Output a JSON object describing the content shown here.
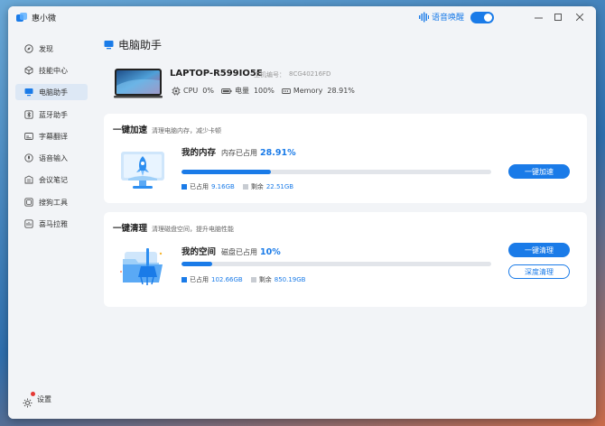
{
  "app": {
    "name": "惠小微"
  },
  "titlebar": {
    "wake_label": "语音唤醒",
    "wake_enabled": true
  },
  "sidebar": {
    "items": [
      {
        "label": "发现",
        "icon": "compass-icon"
      },
      {
        "label": "技能中心",
        "icon": "cube-icon"
      },
      {
        "label": "电脑助手",
        "icon": "monitor-icon",
        "active": true
      },
      {
        "label": "蓝牙助手",
        "icon": "bluetooth-icon"
      },
      {
        "label": "字幕翻译",
        "icon": "subtitle-icon"
      },
      {
        "label": "语音输入",
        "icon": "microphone-icon"
      },
      {
        "label": "会议笔记",
        "icon": "notes-icon"
      },
      {
        "label": "搜狗工具",
        "icon": "toolbox-icon"
      },
      {
        "label": "喜马拉雅",
        "icon": "podcast-icon"
      }
    ],
    "settings_label": "设置"
  },
  "page": {
    "title": "电脑助手"
  },
  "device": {
    "name": "LAPTOP-R599IO5E",
    "serial_label": "主机编号：",
    "serial": "8CG40216FD",
    "cpu_label": "CPU",
    "cpu_value": "0%",
    "battery_label": "电量",
    "battery_value": "100%",
    "memory_label": "Memory",
    "memory_value": "28.91%"
  },
  "accelerate": {
    "title": "一键加速",
    "subtitle": "清理电脑内存，减少卡顿",
    "heading": "我的内存",
    "desc": "内存已占用",
    "percent_text": "28.91%",
    "percent": 28.91,
    "used_label": "已占用",
    "used_value": "9.16GB",
    "free_label": "剩余",
    "free_value": "22.51GB",
    "button": "一键加速"
  },
  "clean": {
    "title": "一键清理",
    "subtitle": "清理磁盘空间，提升电脑性能",
    "heading": "我的空间",
    "desc": "磁盘已占用",
    "percent_text": "10%",
    "percent": 10,
    "used_label": "已占用",
    "used_value": "102.66GB",
    "free_label": "剩余",
    "free_value": "850.19GB",
    "button_primary": "一键清理",
    "button_secondary": "深度清理"
  },
  "colors": {
    "accent": "#1a7be8",
    "track": "#e2e5ea",
    "free_swatch": "#c8ccd2"
  }
}
